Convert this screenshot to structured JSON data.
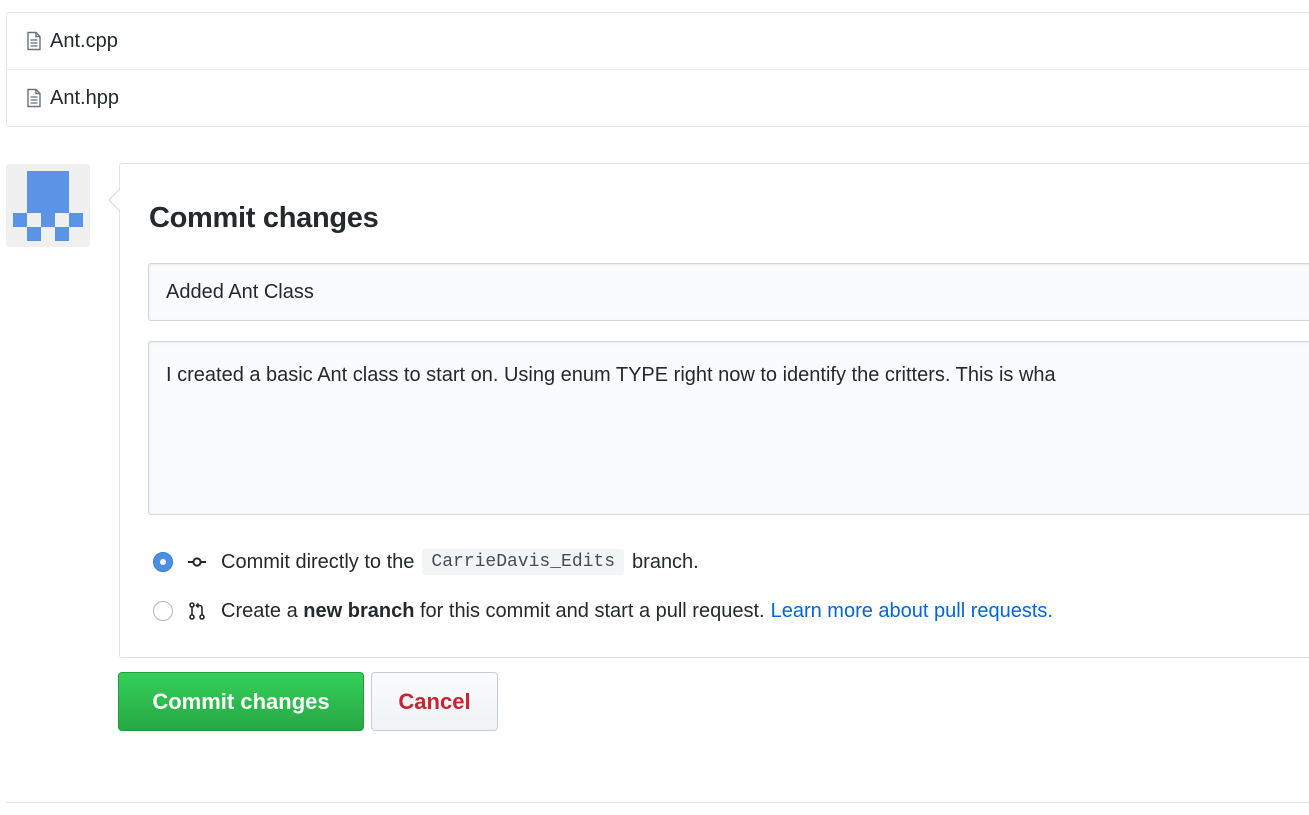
{
  "files": [
    {
      "name": "Ant.cpp",
      "icon": "file-text-icon"
    },
    {
      "name": "Ant.hpp",
      "icon": "file-text-icon"
    }
  ],
  "commit_form": {
    "title": "Commit changes",
    "summary_value": "Added Ant Class",
    "description_value": "I created a basic Ant class to start on. Using enum TYPE right now to identify the critters. This is wha",
    "option_direct": {
      "selected": true,
      "icon": "git-commit-icon",
      "text_before": "Commit directly to the",
      "branch_name": "CarrieDavis_Edits",
      "text_after": "branch."
    },
    "option_new_branch": {
      "selected": false,
      "icon": "git-pull-request-icon",
      "text_before": "Create a",
      "bold_text": "new branch",
      "text_after": "for this commit and start a pull request.",
      "link_text": "Learn more about pull requests."
    },
    "submit_label": "Commit changes",
    "cancel_label": "Cancel"
  },
  "colors": {
    "primary_button": "#28a745",
    "cancel_text": "#cb2431",
    "link": "#0366d6",
    "radio_selected": "#4a90e2",
    "avatar": "#5b93e6"
  }
}
